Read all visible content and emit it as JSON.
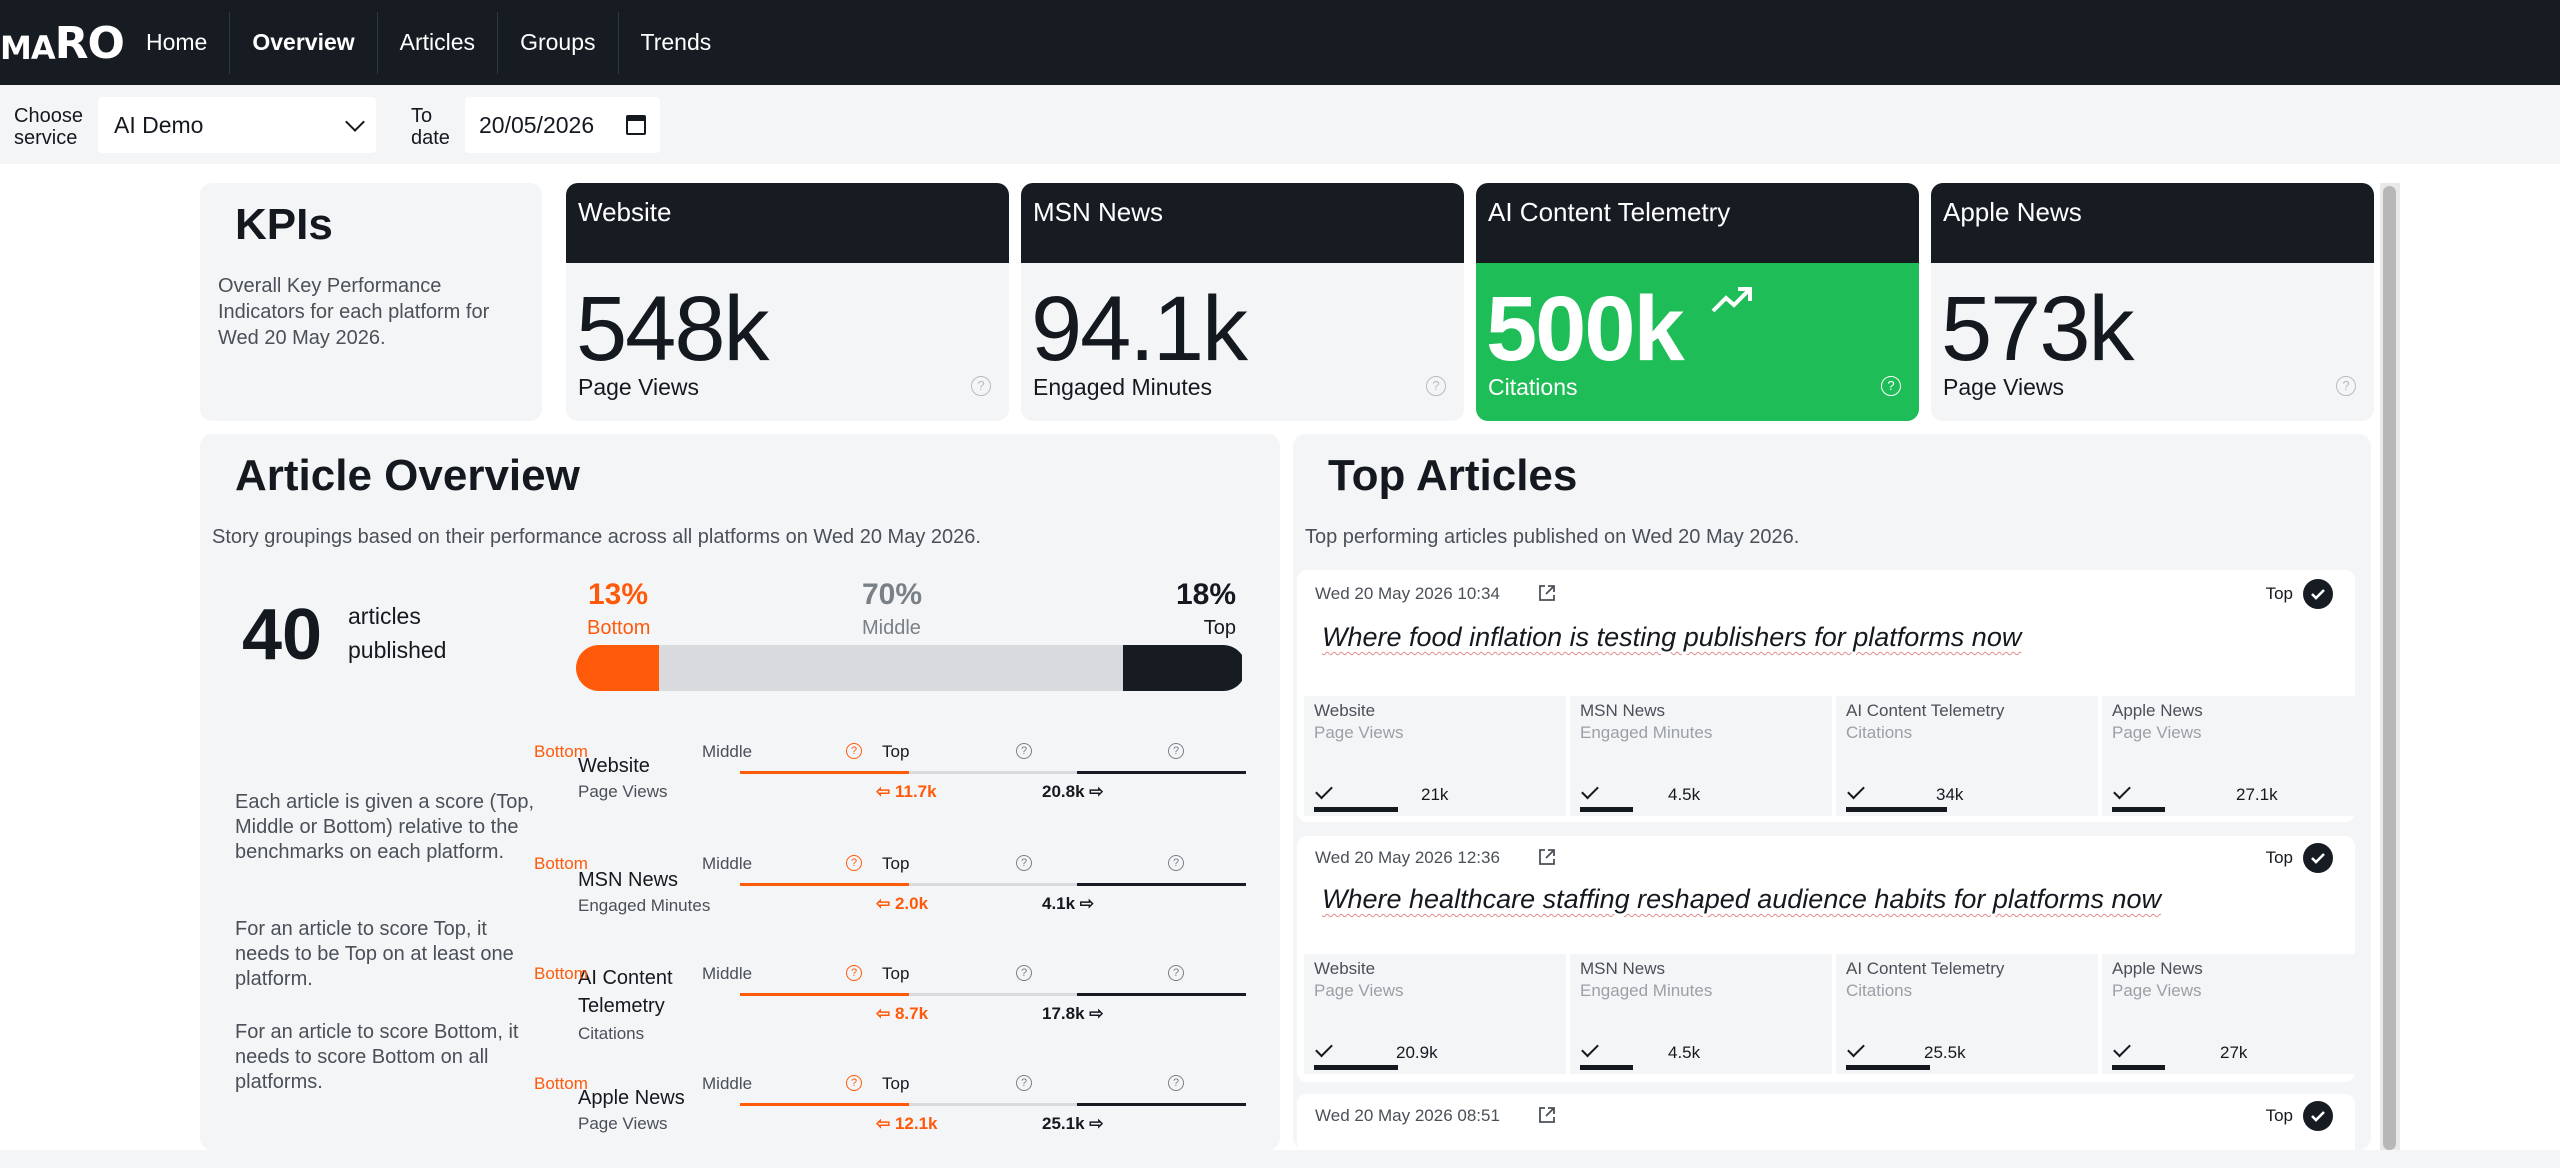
{
  "app": {
    "logo_small": "MA",
    "logo_large": "RO"
  },
  "nav": {
    "items": [
      "Home",
      "Overview",
      "Articles",
      "Groups",
      "Trends"
    ],
    "active": "Overview"
  },
  "filters": {
    "service_label": "Choose service",
    "service_value": "AI Demo",
    "date_label": "To date",
    "date_value": "20/05/2026"
  },
  "kpis": {
    "title": "KPIs",
    "description": "Overall Key Performance Indicators for each platform for Wed 20 May 2026.",
    "cards": [
      {
        "platform": "Website",
        "value": "548k",
        "metric": "Page Views",
        "highlight": false
      },
      {
        "platform": "MSN News",
        "value": "94.1k",
        "metric": "Engaged Minutes",
        "highlight": false
      },
      {
        "platform": "AI Content Telemetry",
        "value": "500k",
        "metric": "Citations",
        "highlight": true,
        "trend_icon": "trending-up-icon"
      },
      {
        "platform": "Apple News",
        "value": "573k",
        "metric": "Page Views",
        "highlight": false
      }
    ],
    "help_glyph": "?"
  },
  "overview": {
    "title": "Article Overview",
    "subtitle": "Story groupings based on their performance across all platforms on Wed 20 May 2026.",
    "count": "40",
    "count_label_1": "articles",
    "count_label_2": "published",
    "split": [
      {
        "pct": "13%",
        "label": "Bottom",
        "share": 13
      },
      {
        "pct": "70%",
        "label": "Middle",
        "share": 70
      },
      {
        "pct": "18%",
        "label": "Top",
        "share": 18
      }
    ],
    "explanation": [
      "Each article is given a score (Top, Middle or Bottom) relative to the benchmarks on each platform.",
      "For an article to score Top, it needs to be Top on at least one platform.",
      "For an article to score Bottom, it needs to score Bottom on all platforms."
    ],
    "levels": [
      "Bottom",
      "Middle",
      "Top"
    ],
    "platforms": [
      {
        "name": "Website",
        "metric": "Page Views",
        "low": "⇦ 11.7k",
        "high": "20.8k ⇨"
      },
      {
        "name": "MSN News",
        "metric": "Engaged Minutes",
        "low": "⇦ 2.0k",
        "high": "4.1k ⇨"
      },
      {
        "name": "AI Content Telemetry",
        "metric": "Citations",
        "low": "⇦ 8.7k",
        "high": "17.8k ⇨"
      },
      {
        "name": "Apple News",
        "metric": "Page Views",
        "low": "⇦ 12.1k",
        "high": "25.1k ⇨"
      }
    ]
  },
  "top_articles": {
    "title": "Top Articles",
    "subtitle": "Top performing articles published on Wed 20 May 2026.",
    "badge": "Top",
    "metric_labels": [
      {
        "platform": "Website",
        "metric": "Page Views"
      },
      {
        "platform": "MSN News",
        "metric": "Engaged Minutes"
      },
      {
        "platform": "AI Content Telemetry",
        "metric": "Citations"
      },
      {
        "platform": "Apple News",
        "metric": "Page Views"
      }
    ],
    "articles": [
      {
        "date": "Wed 20 May 2026 10:34",
        "title": "Where food inflation is testing publishers for platforms now",
        "values": [
          "21k",
          "4.5k",
          "34k",
          "27.1k"
        ],
        "levels": [
          0.6,
          0.38,
          0.72,
          0.38
        ]
      },
      {
        "date": "Wed 20 May 2026 12:36",
        "title": "Where healthcare staffing reshaped audience habits for platforms now",
        "values": [
          "20.9k",
          "4.5k",
          "25.5k",
          "27k"
        ],
        "levels": [
          0.6,
          0.38,
          0.6,
          0.38
        ]
      },
      {
        "date": "Wed 20 May 2026 08:51",
        "title": "",
        "values": [],
        "levels": []
      }
    ]
  },
  "colors": {
    "dark": "#161c22",
    "accent_orange": "#ff5a0a",
    "green": "#1fbd57",
    "middle_grey": "#d8dadd"
  }
}
